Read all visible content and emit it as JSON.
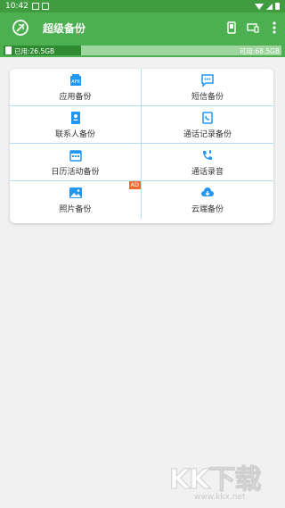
{
  "status_bar": {
    "time": "10:42"
  },
  "app_bar": {
    "title": "超级备份",
    "icons": [
      "phone-icon",
      "devices-icon",
      "more-vert-icon"
    ]
  },
  "storage": {
    "used_label": "已用:26.5GB",
    "free_label": "可用:68.5GB",
    "used_fraction": 0.279
  },
  "grid": {
    "items": [
      {
        "label": "应用备份",
        "icon": "app-backup-icon"
      },
      {
        "label": "短信备份",
        "icon": "sms-icon"
      },
      {
        "label": "联系人备份",
        "icon": "contacts-icon"
      },
      {
        "label": "通话记录备份",
        "icon": "call-log-icon"
      },
      {
        "label": "日历活动备份",
        "icon": "calendar-icon"
      },
      {
        "label": "通话录音",
        "icon": "call-record-icon"
      },
      {
        "label": "照片备份",
        "icon": "photo-icon",
        "badge": "AD"
      },
      {
        "label": "云端备份",
        "icon": "cloud-icon"
      }
    ]
  },
  "watermark": {
    "text": "KK下载",
    "url": "www.kkx.net"
  },
  "colors": {
    "primary": "#4caf50",
    "accent": "#2196f3",
    "ad": "#ec6a2d"
  }
}
